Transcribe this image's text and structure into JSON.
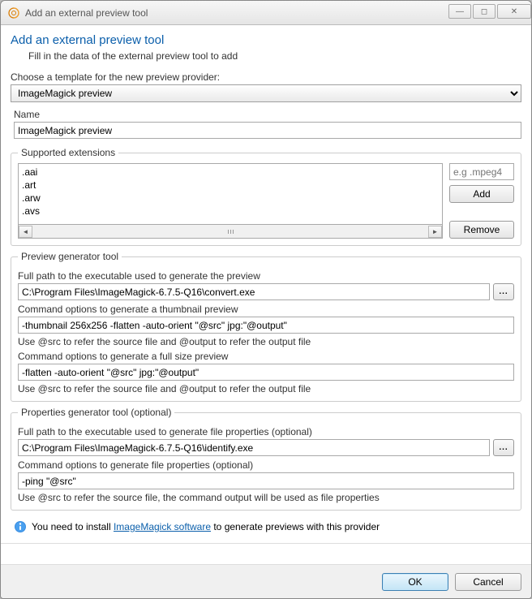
{
  "window": {
    "title": "Add an external preview tool"
  },
  "header": {
    "heading": "Add an external preview tool",
    "subheading": "Fill in the data of the external preview tool to add"
  },
  "template": {
    "label": "Choose a template for the new preview provider:",
    "selected": "ImageMagick preview"
  },
  "name": {
    "label": "Name",
    "value": "ImageMagick preview"
  },
  "extensions": {
    "legend": "Supported extensions",
    "items": [
      ".aai",
      ".art",
      ".arw",
      ".avs"
    ],
    "placeholder": "e.g .mpeg4",
    "add_label": "Add",
    "remove_label": "Remove"
  },
  "generator": {
    "legend": "Preview generator tool",
    "exe_label": "Full path to the executable used to generate the preview",
    "exe_value": "C:\\Program Files\\ImageMagick-6.7.5-Q16\\convert.exe",
    "thumb_label": "Command options to generate a thumbnail preview",
    "thumb_value": "-thumbnail 256x256 -flatten -auto-orient \"@src\" jpg:\"@output\"",
    "thumb_hint": "Use @src to refer the source file and @output to refer the output file",
    "full_label": "Command options to generate a full size preview",
    "full_value": "-flatten -auto-orient \"@src\" jpg:\"@output\"",
    "full_hint": "Use @src to refer the source file and @output to refer the output file"
  },
  "properties": {
    "legend": "Properties generator tool (optional)",
    "exe_label": "Full path to the executable used to generate file properties (optional)",
    "exe_value": "C:\\Program Files\\ImageMagick-6.7.5-Q16\\identify.exe",
    "cmd_label": "Command options to generate file properties (optional)",
    "cmd_value": "-ping \"@src\"",
    "cmd_hint": "Use @src to refer the source file, the command output will be used as file properties"
  },
  "info": {
    "prefix": "You need to install ",
    "link": "ImageMagick software",
    "suffix": " to generate previews with this provider"
  },
  "buttons": {
    "ok": "OK",
    "cancel": "Cancel"
  }
}
